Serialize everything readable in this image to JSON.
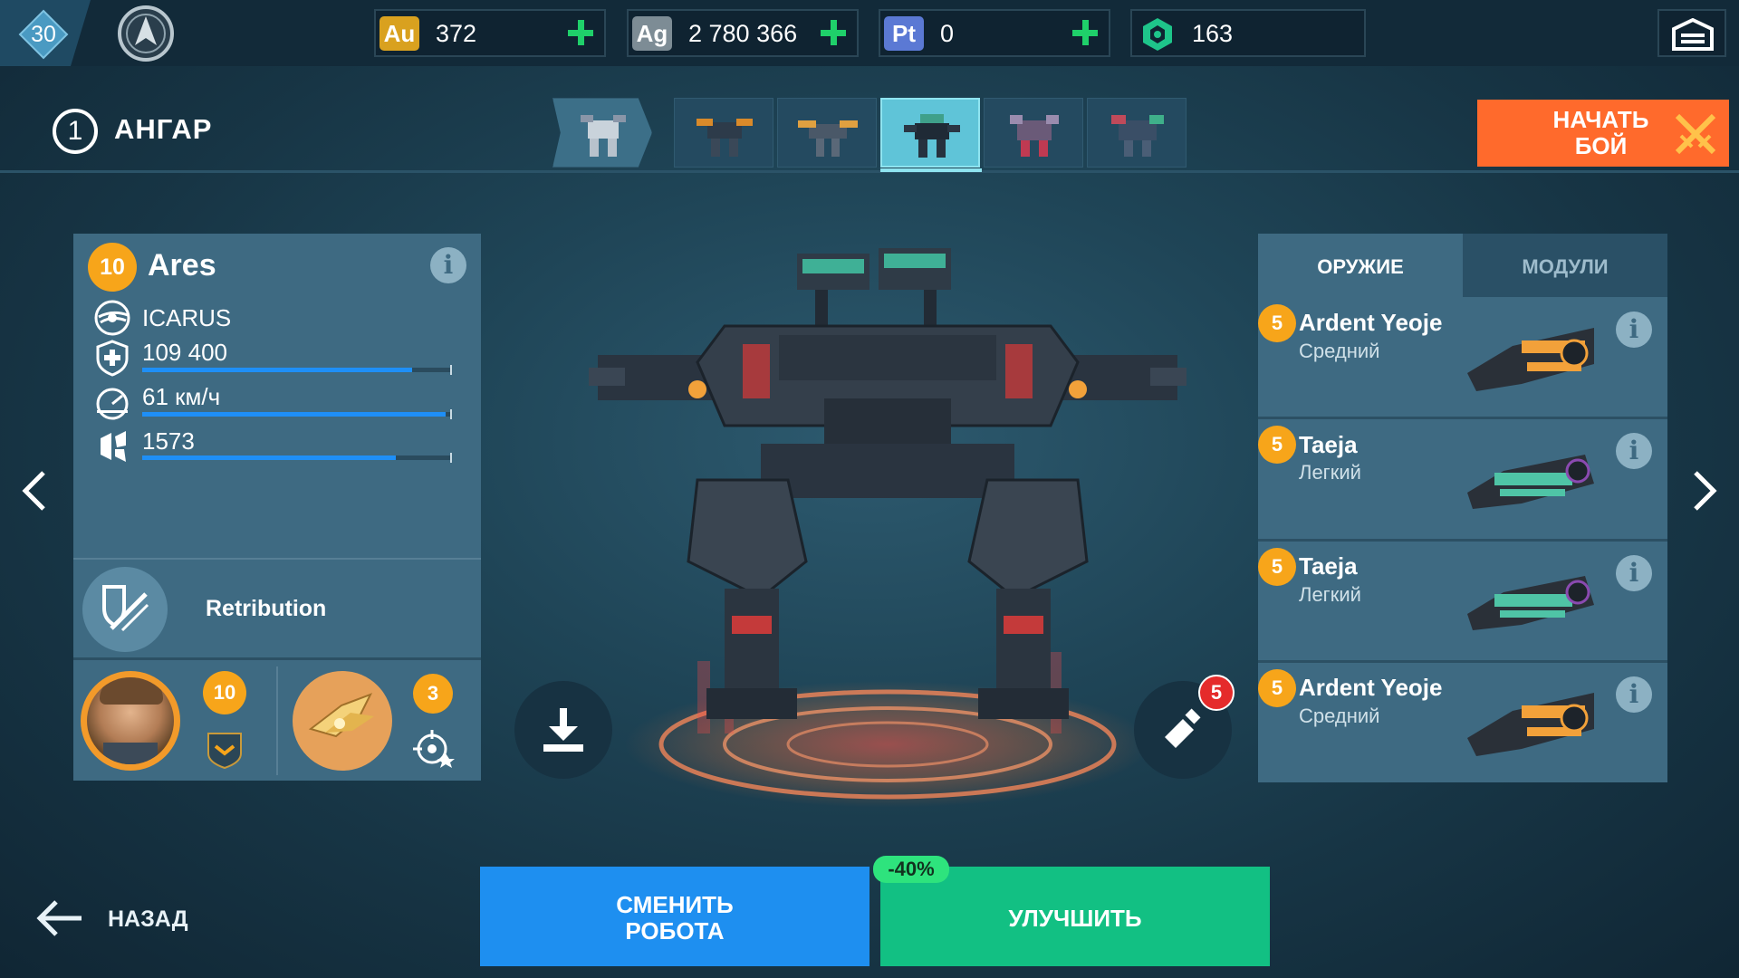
{
  "topbar": {
    "player_level": "30",
    "resources": [
      {
        "code": "Au",
        "value": "372",
        "color": "#d9a11f"
      },
      {
        "code": "Ag",
        "value": "2 780 366",
        "color": "#7d8c95"
      },
      {
        "code": "Pt",
        "value": "0",
        "color": "#5b79d4"
      },
      {
        "code": "hex-token",
        "value": "163",
        "color": "#1ec58a"
      }
    ]
  },
  "hangar": {
    "number": "1",
    "title": "АНГАР",
    "robot_tabs": [
      "robot-1",
      "robot-2",
      "robot-3",
      "robot-4",
      "robot-5",
      "robot-6"
    ],
    "selected_tab_index": 3
  },
  "start_battle": {
    "label_line1": "НАЧАТЬ",
    "label_line2": "БОЙ",
    "color": "#ff6a2c"
  },
  "robot": {
    "level": "10",
    "name": "Ares",
    "faction": "ICARUS",
    "stats": [
      {
        "icon": "shield-plus-icon",
        "value": "109 400",
        "fill": 0.87
      },
      {
        "icon": "speed-icon",
        "value": "61 км/ч",
        "fill": 0.98
      },
      {
        "icon": "damage-icon",
        "value": "1573",
        "fill": 0.82
      }
    ],
    "ability": "Retribution",
    "pilot": {
      "level": "10"
    },
    "drone": {
      "level": "3"
    }
  },
  "customize": {
    "paint_badge": "5"
  },
  "weapons_panel": {
    "tab_weapons": "ОРУЖИЕ",
    "tab_modules": "МОДУЛИ",
    "items": [
      {
        "level": "5",
        "name": "Ardent Yeoje",
        "class": "Средний",
        "theme": "orange"
      },
      {
        "level": "5",
        "name": "Taeja",
        "class": "Легкий",
        "theme": "teal"
      },
      {
        "level": "5",
        "name": "Taeja",
        "class": "Легкий",
        "theme": "teal"
      },
      {
        "level": "5",
        "name": "Ardent Yeoje",
        "class": "Средний",
        "theme": "orange"
      }
    ]
  },
  "bottom": {
    "back_label": "НАЗАД",
    "change_line1": "СМЕНИТЬ",
    "change_line2": "РОБОТА",
    "upgrade_label": "УЛУЧШИТЬ",
    "discount": "-40%"
  }
}
